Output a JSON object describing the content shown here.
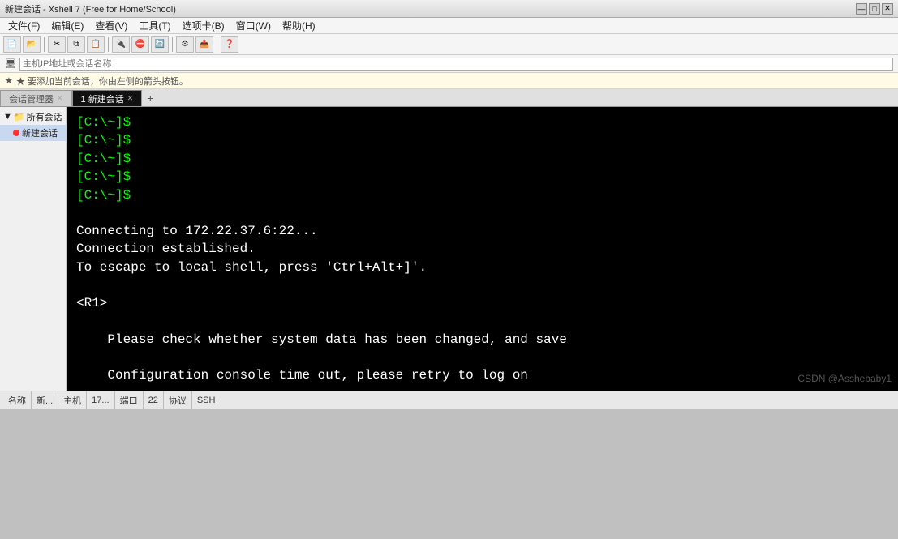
{
  "titlebar": {
    "text": "新建会话 - Xshell 7 (Free for Home/School)",
    "minimize": "—",
    "maximize": "□",
    "close": "✕"
  },
  "menubar": {
    "items": [
      "文件(F)",
      "编辑(E)",
      "查看(V)",
      "工具(T)",
      "选项卡(B)",
      "窗口(W)",
      "帮助(H)"
    ]
  },
  "addressbar": {
    "icon": "🖥",
    "placeholder": "主机IP地址或会话名称"
  },
  "hintbar": {
    "text": "★ 要添加当前会话，你由左侧的箭头按钮。"
  },
  "tabbar": {
    "tabs": [
      {
        "label": "会话管理器",
        "active": false,
        "closeable": true
      },
      {
        "label": "1 新建会话",
        "active": true,
        "closeable": true
      }
    ],
    "add_label": "+"
  },
  "sidebar": {
    "group_label": "所有会话",
    "items": [
      {
        "label": "新建会话"
      }
    ]
  },
  "terminal": {
    "prompt_lines": [
      "[C:\\~]$",
      "[C:\\~]$",
      "[C:\\~]$",
      "[C:\\~]$",
      "[C:\\~]$"
    ],
    "blank1": "",
    "connecting_line": "Connecting to 172.22.37.6:22...",
    "established_line": "Connection established.",
    "escape_line": "To escape to local shell, press 'Ctrl+Alt+]'.",
    "blank2": "",
    "r1_line": "<R1>",
    "blank3": "",
    "please_line": "    Please check whether system data has been changed, and save",
    "blank4": "",
    "config_line": "    Configuration console time out, please retry to log on"
  },
  "statusbar": {
    "name_label": "名称",
    "name_value": "新...",
    "host_label": "主机",
    "host_value": "17...",
    "port_label": "端口",
    "port_value": "22",
    "proto_label": "协议",
    "proto_value": "SSH"
  },
  "watermark": {
    "text": "CSDN @Asshebaby1"
  }
}
